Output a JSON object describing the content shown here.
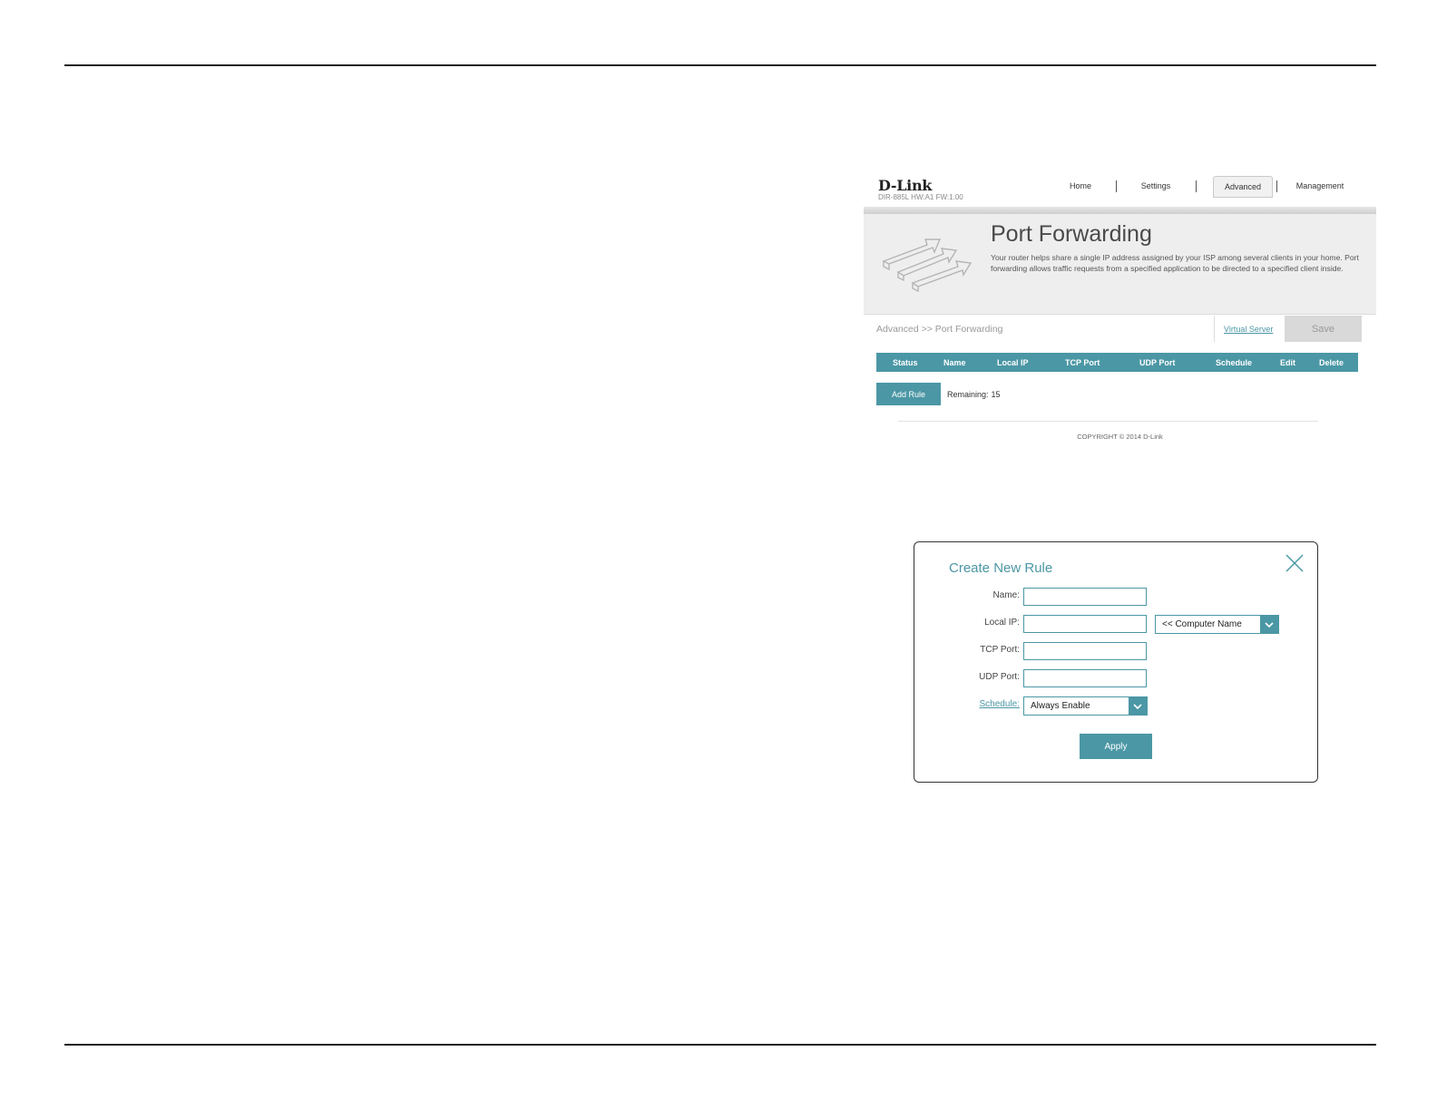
{
  "router_page": {
    "logo": "D-Link",
    "model_info": "DIR-885L  HW:A1   FW:1.00",
    "nav": {
      "home": "Home",
      "settings": "Settings",
      "advanced": "Advanced",
      "management": "Management"
    },
    "banner": {
      "title": "Port Forwarding",
      "description": "Your router helps share a single IP address assigned by your ISP among several clients in your home. Port forwarding allows traffic requests from a specified application to be directed to a specified client inside."
    },
    "breadcrumb": "Advanced >> Port Forwarding",
    "virtual_server_link": "Virtual Server",
    "save_label": "Save",
    "table_headers": [
      "Status",
      "Name",
      "Local IP",
      "TCP Port",
      "UDP Port",
      "Schedule",
      "Edit",
      "Delete"
    ],
    "add_rule_label": "Add Rule",
    "remaining_label": "Remaining:",
    "remaining_count": "15",
    "copyright": "COPYRIGHT © 2014 D-Link"
  },
  "dialog": {
    "title": "Create New Rule",
    "fields": {
      "name_label": "Name:",
      "name_value": "",
      "local_ip_label": "Local IP:",
      "local_ip_value": "",
      "computer_name_selected": "<< Computer Name",
      "tcp_port_label": "TCP Port:",
      "tcp_port_value": "",
      "udp_port_label": "UDP Port:",
      "udp_port_value": "",
      "schedule_label": "Schedule:",
      "schedule_selected": "Always Enable"
    },
    "apply_label": "Apply"
  },
  "colors": {
    "accent": "#4b97a5",
    "save_disabled_bg": "#d9d9d9",
    "banner_bg": "#eeeeee",
    "rule_line": "#222222"
  },
  "icons": {
    "banner": "port-forwarding-arrows-icon",
    "close": "close-icon",
    "dropdown": "chevron-down-icon"
  }
}
